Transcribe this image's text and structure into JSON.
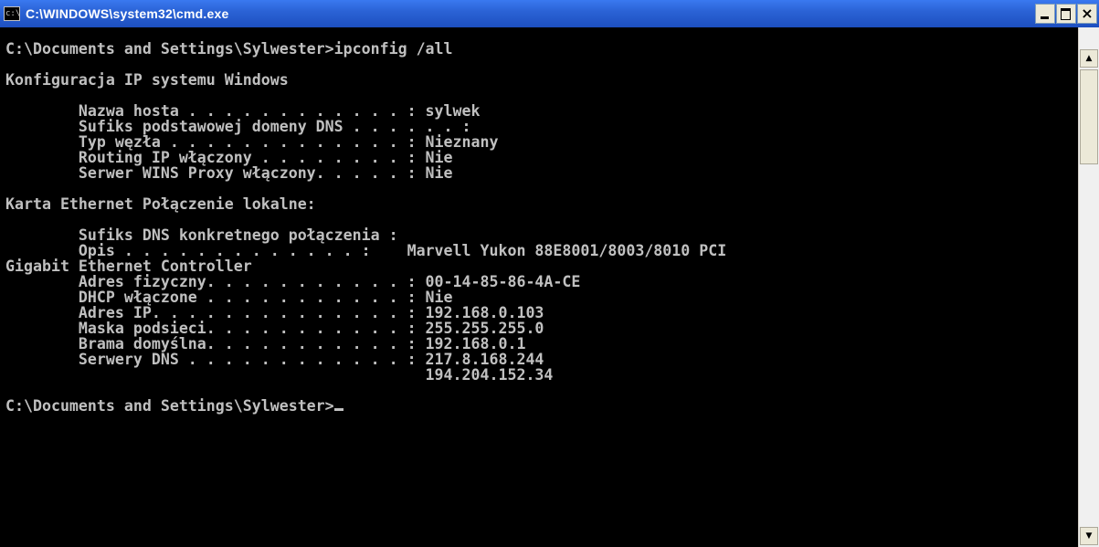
{
  "window": {
    "title": "C:\\WINDOWS\\system32\\cmd.exe",
    "icon": "console-icon",
    "icon_glyph": "c:\\"
  },
  "controls": {
    "minimize": "minimize",
    "maximize": "maximize",
    "close_glyph": "×"
  },
  "scrollbar": {
    "up_glyph": "▲",
    "down_glyph": "▼"
  },
  "console": {
    "lines": [
      "C:\\Documents and Settings\\Sylwester>ipconfig /all",
      "",
      "Konfiguracja IP systemu Windows",
      "",
      "        Nazwa hosta . . . . . . . . . . . . : sylwek",
      "        Sufiks podstawowej domeny DNS . . . . . . :",
      "        Typ węzła . . . . . . . . . . . . . : Nieznany",
      "        Routing IP włączony . . . . . . . . : Nie",
      "        Serwer WINS Proxy włączony. . . . . : Nie",
      "",
      "Karta Ethernet Połączenie lokalne:",
      "",
      "        Sufiks DNS konkretnego połączenia :",
      "        Opis . . . . . . . . . . . . . :    Marvell Yukon 88E8001/8003/8010 PCI",
      "Gigabit Ethernet Controller",
      "        Adres fizyczny. . . . . . . . . . . : 00-14-85-86-4A-CE",
      "        DHCP włączone . . . . . . . . . . . : Nie",
      "        Adres IP. . . . . . . . . . . . . . : 192.168.0.103",
      "        Maska podsieci. . . . . . . . . . . : 255.255.255.0",
      "        Brama domyślna. . . . . . . . . . . : 192.168.0.1",
      "        Serwery DNS . . . . . . . . . . . . : 217.8.168.244",
      "                                              194.204.152.34",
      "",
      "C:\\Documents and Settings\\Sylwester>"
    ]
  }
}
